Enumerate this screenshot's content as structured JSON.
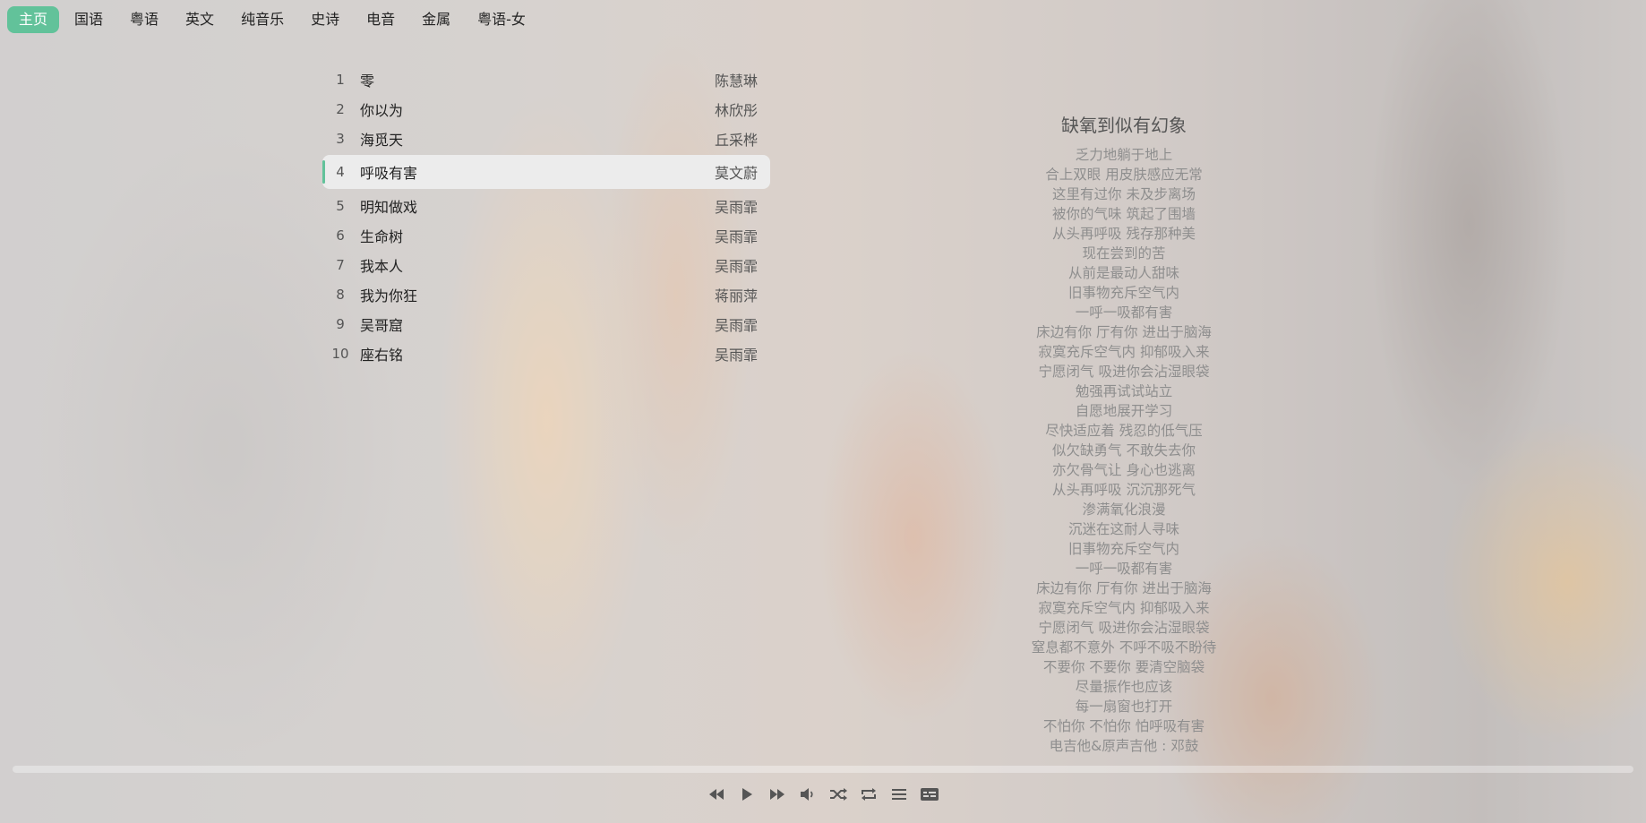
{
  "nav": {
    "items": [
      {
        "label": "主页",
        "active": true
      },
      {
        "label": "国语",
        "active": false
      },
      {
        "label": "粤语",
        "active": false
      },
      {
        "label": "英文",
        "active": false
      },
      {
        "label": "纯音乐",
        "active": false
      },
      {
        "label": "史诗",
        "active": false
      },
      {
        "label": "电音",
        "active": false
      },
      {
        "label": "金属",
        "active": false
      },
      {
        "label": "粤语-女",
        "active": false
      }
    ]
  },
  "songs": [
    {
      "index": "1",
      "title": "零",
      "artist": "陈慧琳"
    },
    {
      "index": "2",
      "title": "你以为",
      "artist": "林欣彤"
    },
    {
      "index": "3",
      "title": "海觅天",
      "artist": "丘采桦"
    },
    {
      "index": "4",
      "title": "呼吸有害",
      "artist": "莫文蔚",
      "playing": true
    },
    {
      "index": "5",
      "title": "明知做戏",
      "artist": "吴雨霏"
    },
    {
      "index": "6",
      "title": "生命树",
      "artist": "吴雨霏"
    },
    {
      "index": "7",
      "title": "我本人",
      "artist": "吴雨霏"
    },
    {
      "index": "8",
      "title": "我为你狂",
      "artist": "蒋丽萍"
    },
    {
      "index": "9",
      "title": "吴哥窟",
      "artist": "吴雨霏"
    },
    {
      "index": "10",
      "title": "座右铭",
      "artist": "吴雨霏"
    }
  ],
  "lyrics": {
    "title": "缺氧到似有幻象",
    "lines": [
      "乏力地躺于地上",
      "合上双眼 用皮肤感应无常",
      "这里有过你 未及步离场",
      "被你的气味 筑起了围墙",
      "从头再呼吸 残存那种美",
      "现在尝到的苦",
      "从前是最动人甜味",
      "旧事物充斥空气内",
      "一呼一吸都有害",
      "床边有你 厅有你 进出于脑海",
      "寂寞充斥空气内 抑郁吸入来",
      "宁愿闭气 吸进你会沾湿眼袋",
      "勉强再试试站立",
      "自愿地展开学习",
      "尽快适应着 残忍的低气压",
      "似欠缺勇气 不敢失去你",
      "亦欠骨气让 身心也逃离",
      "从头再呼吸 沉沉那死气",
      "渗满氧化浪漫",
      "沉迷在这耐人寻味",
      "旧事物充斥空气内",
      "一呼一吸都有害",
      "床边有你 厅有你 进出于脑海",
      "寂寞充斥空气内 抑郁吸入来",
      "宁愿闭气 吸进你会沾湿眼袋",
      "窒息都不意外 不呼不吸不盼待",
      "不要你 不要你 要清空脑袋",
      "尽量振作也应该",
      "每一扇窗也打开",
      "不怕你 不怕你 怕呼吸有害",
      "电吉他&原声吉他 : 邓鼓"
    ]
  },
  "player": {
    "progress": 0.0,
    "controls": [
      {
        "name": "previous-icon"
      },
      {
        "name": "play-icon"
      },
      {
        "name": "next-icon"
      },
      {
        "name": "volume-icon"
      },
      {
        "name": "shuffle-icon"
      },
      {
        "name": "repeat-icon"
      },
      {
        "name": "playlist-icon"
      },
      {
        "name": "lyrics-icon"
      }
    ]
  },
  "colors": {
    "accent": "#62c29a",
    "icon": "#555555"
  }
}
